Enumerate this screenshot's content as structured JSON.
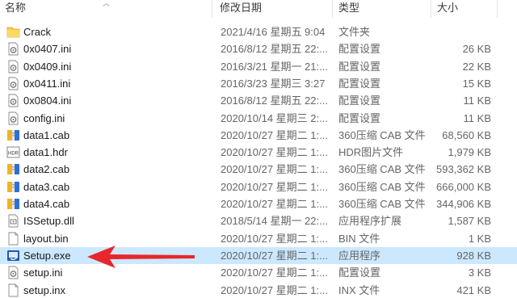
{
  "columns": {
    "name": "名称",
    "date": "修改日期",
    "type": "类型",
    "size": "大小"
  },
  "files": [
    {
      "name": "Crack",
      "date": "2021/4/16 星期五 9:04",
      "type": "文件夹",
      "size": "",
      "icon": "folder-icon"
    },
    {
      "name": "0x0407.ini",
      "date": "2016/8/12 星期五 22:...",
      "type": "配置设置",
      "size": "26 KB",
      "icon": "settings-file-icon"
    },
    {
      "name": "0x0409.ini",
      "date": "2016/3/21 星期一 21:...",
      "type": "配置设置",
      "size": "22 KB",
      "icon": "settings-file-icon"
    },
    {
      "name": "0x0411.ini",
      "date": "2016/3/23 星期三 3:27",
      "type": "配置设置",
      "size": "15 KB",
      "icon": "settings-file-icon"
    },
    {
      "name": "0x0804.ini",
      "date": "2016/8/12 星期五 22:...",
      "type": "配置设置",
      "size": "11 KB",
      "icon": "settings-file-icon"
    },
    {
      "name": "config.ini",
      "date": "2020/10/14 星期三 2:...",
      "type": "配置设置",
      "size": "11 KB",
      "icon": "settings-file-icon"
    },
    {
      "name": "data1.cab",
      "date": "2020/10/27 星期二 1:...",
      "type": "360压缩 CAB 文件",
      "size": "68,560 KB",
      "icon": "archive-icon"
    },
    {
      "name": "data1.hdr",
      "date": "2020/10/27 星期二 1:...",
      "type": "HDR图片文件",
      "size": "1,979 KB",
      "icon": "hdr-image-icon"
    },
    {
      "name": "data2.cab",
      "date": "2020/10/27 星期二 1:...",
      "type": "360压缩 CAB 文件",
      "size": "593,362 KB",
      "icon": "archive-icon"
    },
    {
      "name": "data3.cab",
      "date": "2020/10/27 星期二 1:...",
      "type": "360压缩 CAB 文件",
      "size": "666,000 KB",
      "icon": "archive-icon"
    },
    {
      "name": "data4.cab",
      "date": "2020/10/27 星期二 1:...",
      "type": "360压缩 CAB 文件",
      "size": "344,906 KB",
      "icon": "archive-icon"
    },
    {
      "name": "ISSetup.dll",
      "date": "2018/5/14 星期一 22:...",
      "type": "应用程序扩展",
      "size": "1,587 KB",
      "icon": "dll-file-icon"
    },
    {
      "name": "layout.bin",
      "date": "2020/10/27 星期二 1:...",
      "type": "BIN 文件",
      "size": "1 KB",
      "icon": "blank-file-icon"
    },
    {
      "name": "Setup.exe",
      "date": "2020/10/27 星期二 1:...",
      "type": "应用程序",
      "size": "928 KB",
      "icon": "setup-exe-icon",
      "selected": true
    },
    {
      "name": "setup.ini",
      "date": "2020/10/27 星期二 1:...",
      "type": "配置设置",
      "size": "3 KB",
      "icon": "settings-file-icon"
    },
    {
      "name": "setup.inx",
      "date": "2020/10/27 星期二 1:...",
      "type": "INX 文件",
      "size": "421 KB",
      "icon": "blank-file-icon"
    }
  ],
  "colors": {
    "selection": "#cce8ff",
    "arrow": "#e8262b",
    "folder": "#f7c948"
  }
}
